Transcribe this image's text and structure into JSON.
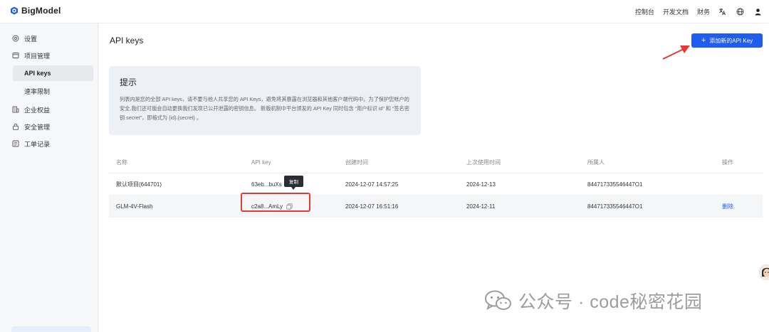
{
  "brand": {
    "name": "BigModel",
    "color": "#1f5cf0"
  },
  "topnav": {
    "links": [
      "控制台",
      "开发文档",
      "财务"
    ],
    "icons": [
      "translate-icon",
      "globe-icon",
      "user-icon"
    ]
  },
  "sidebar": {
    "items": [
      {
        "label": "设置",
        "icon": "settings-icon"
      },
      {
        "label": "项目管理",
        "icon": "project-icon"
      },
      {
        "label": "API keys",
        "active": true
      },
      {
        "label": "速率限制"
      },
      {
        "label": "企业权益",
        "icon": "building-icon"
      },
      {
        "label": "安全管理",
        "icon": "lock-icon"
      },
      {
        "label": "工单记录",
        "icon": "ticket-icon"
      }
    ]
  },
  "main": {
    "title": "API keys",
    "add_button": "添加新的API Key",
    "tip": {
      "title": "提示",
      "body": "列表内是您的全部 API keys，请不要与他人共享您的 API Keys，避免将其暴露在浏览器和其他客户端代码中。为了保护您帐户的安全,我们还可能会自动更换我们发现已公开泄露的密钥信息。 新版机制中平台颁发的 API Key 同时包含 “用户标识 id” 和 “签名密钥 secret”，即格式为 {id}.{secret} 。"
    },
    "table": {
      "columns": [
        "名称",
        "API key",
        "创建时间",
        "上次使用时间",
        "所属人",
        "操作"
      ],
      "rows": [
        {
          "name": "默认项目(644701)",
          "key": "63eb...buXs",
          "created": "2024-12-07 14:57:25",
          "last_used": "2024-12-13",
          "owner": "844717335546447O1",
          "action": ""
        },
        {
          "name": "GLM-4V-Flash",
          "key": "c2a8...AmLy",
          "created": "2024-12-07 16:51:16",
          "last_used": "2024-12-11",
          "owner": "844717335546447O1",
          "action": "删除"
        }
      ]
    },
    "tooltip": "复制"
  },
  "watermark": {
    "text": "公众号 · code秘密花园"
  },
  "colors": {
    "accent": "#1f5cf0",
    "annotation": "#e53935"
  }
}
